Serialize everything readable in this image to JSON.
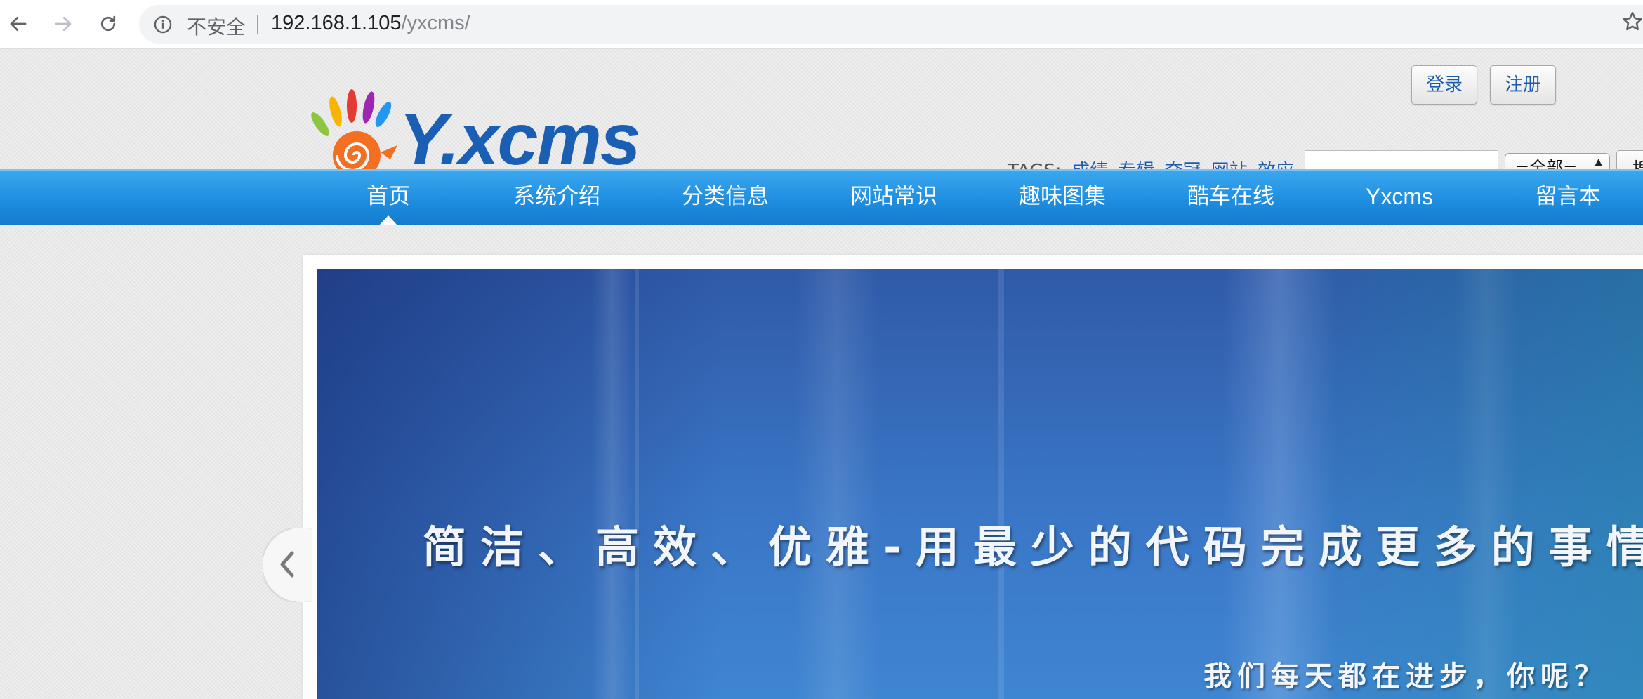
{
  "browser": {
    "security_label": "不安全",
    "url_host": "192.168.1.105",
    "url_path": "/yxcms/"
  },
  "header": {
    "logo_text": "Y.xcms",
    "login_label": "登录",
    "register_label": "注册",
    "tags_prefix": "TAGS:",
    "tags": [
      "成绩",
      "专辑",
      "夺冠",
      "网站",
      "效应"
    ],
    "tags_more": "...",
    "search_placeholder": "",
    "search_scope": "=全部=",
    "search_button_label": "搜索"
  },
  "nav": {
    "items": [
      {
        "label": "首页",
        "active": true
      },
      {
        "label": "系统介绍",
        "active": false
      },
      {
        "label": "分类信息",
        "active": false
      },
      {
        "label": "网站常识",
        "active": false
      },
      {
        "label": "趣味图集",
        "active": false
      },
      {
        "label": "酷车在线",
        "active": false
      },
      {
        "label": "Yxcms",
        "active": false
      },
      {
        "label": "留言本",
        "active": false
      }
    ]
  },
  "banner": {
    "headline": "简洁、高效、优雅-用最少的代码完成更多的事情",
    "subline": "我们每天都在进步，你呢？"
  },
  "colors": {
    "nav_blue": "#1f8ee0",
    "link_blue": "#1c5cae",
    "banner_blue": "#3a76c6"
  }
}
